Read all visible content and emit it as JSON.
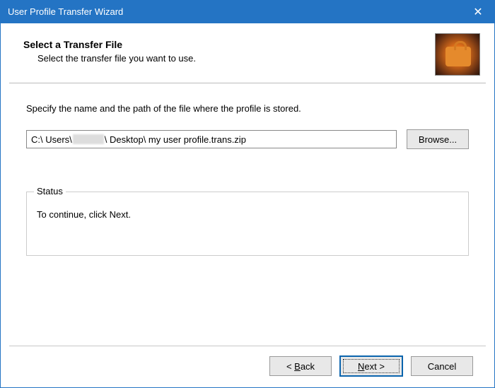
{
  "titlebar": {
    "title": "User Profile Transfer Wizard",
    "close": "✕"
  },
  "header": {
    "title": "Select a Transfer File",
    "subtitle": "Select the transfer file you want to use.",
    "icon": "suitcase-icon"
  },
  "body": {
    "instruction": "Specify the name and the path of the file where the profile is stored.",
    "path_prefix": "C:\\ Users\\ ",
    "path_suffix": " \\ Desktop\\ my user profile.trans.zip",
    "browse_label": "Browse..."
  },
  "status": {
    "legend": "Status",
    "text": "To continue, click Next."
  },
  "footer": {
    "back_pre": "< ",
    "back_mn": "B",
    "back_post": "ack",
    "next_mn": "N",
    "next_post": "ext >",
    "cancel": "Cancel"
  }
}
